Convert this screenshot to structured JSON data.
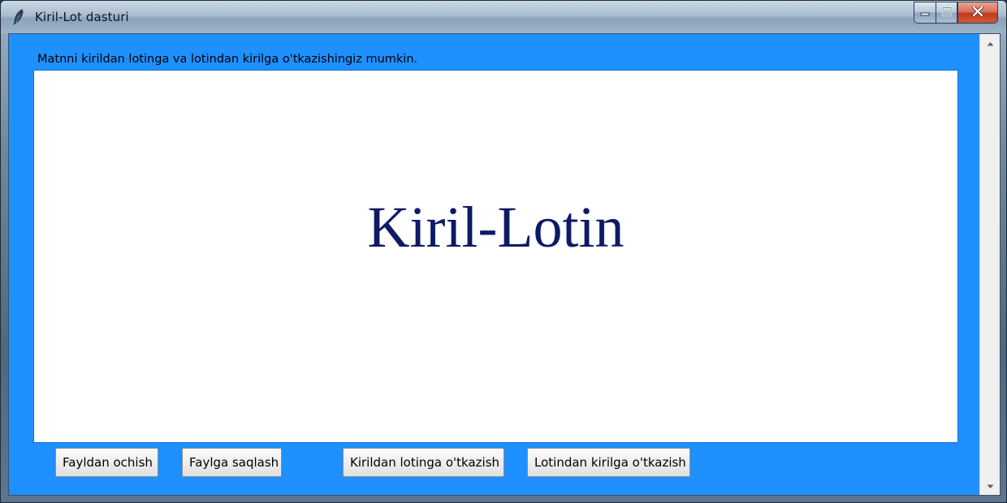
{
  "window": {
    "title": "Kiril-Lot dasturi",
    "icon": "feather-icon"
  },
  "controls": {
    "minimize": "minimize-icon",
    "maximize": "maximize-icon",
    "close": "close-icon"
  },
  "main": {
    "instruction": "Matnni kirildan lotinga va lotindan kirilga o'tkazishingiz mumkin.",
    "text_value": "Kiril-Lotin"
  },
  "buttons": {
    "open_file": "Fayldan ochish",
    "save_file": "Faylga saqlash",
    "cyrillic_to_latin": "Kirildan lotinga o'tkazish",
    "latin_to_cyrillic": "Lotindan kirilga o'tkazish"
  },
  "colors": {
    "client_background": "#1e90ff",
    "text_color": "#0d1a66",
    "close_button": "#c0391e"
  }
}
